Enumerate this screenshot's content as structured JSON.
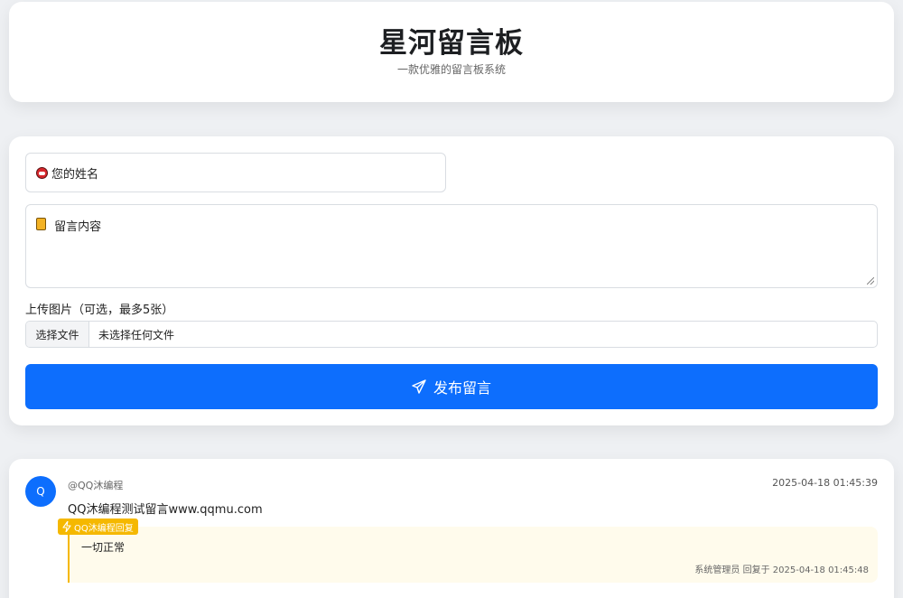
{
  "header": {
    "title": "星河留言板",
    "subtitle": "一款优雅的留言板系统"
  },
  "form": {
    "name_placeholder": "您的姓名",
    "name_icon": "face-emoji-icon",
    "content_placeholder": "留言内容",
    "content_icon": "memo-emoji-icon",
    "upload_label": "上传图片（可选，最多5张）",
    "file_button": "选择文件",
    "file_status": "未选择任何文件",
    "submit_label": "发布留言",
    "submit_icon": "send-icon"
  },
  "messages": [
    {
      "avatar_letter": "Q",
      "author": "@QQ沐编程",
      "time": "2025-04-18 01:45:39",
      "text": "QQ沐编程测试留言www.qqmu.com",
      "reply": {
        "badge": "QQ沐编程回复",
        "badge_icon": "lightning-icon",
        "text": "一切正常",
        "meta": "系统管理员 回复于 2025-04-18 01:45:48"
      }
    }
  ],
  "colors": {
    "accent": "#0d6efd",
    "reply_accent": "#f5b800",
    "reply_bg": "#fffbec",
    "page_bg": "#eef0f3"
  }
}
